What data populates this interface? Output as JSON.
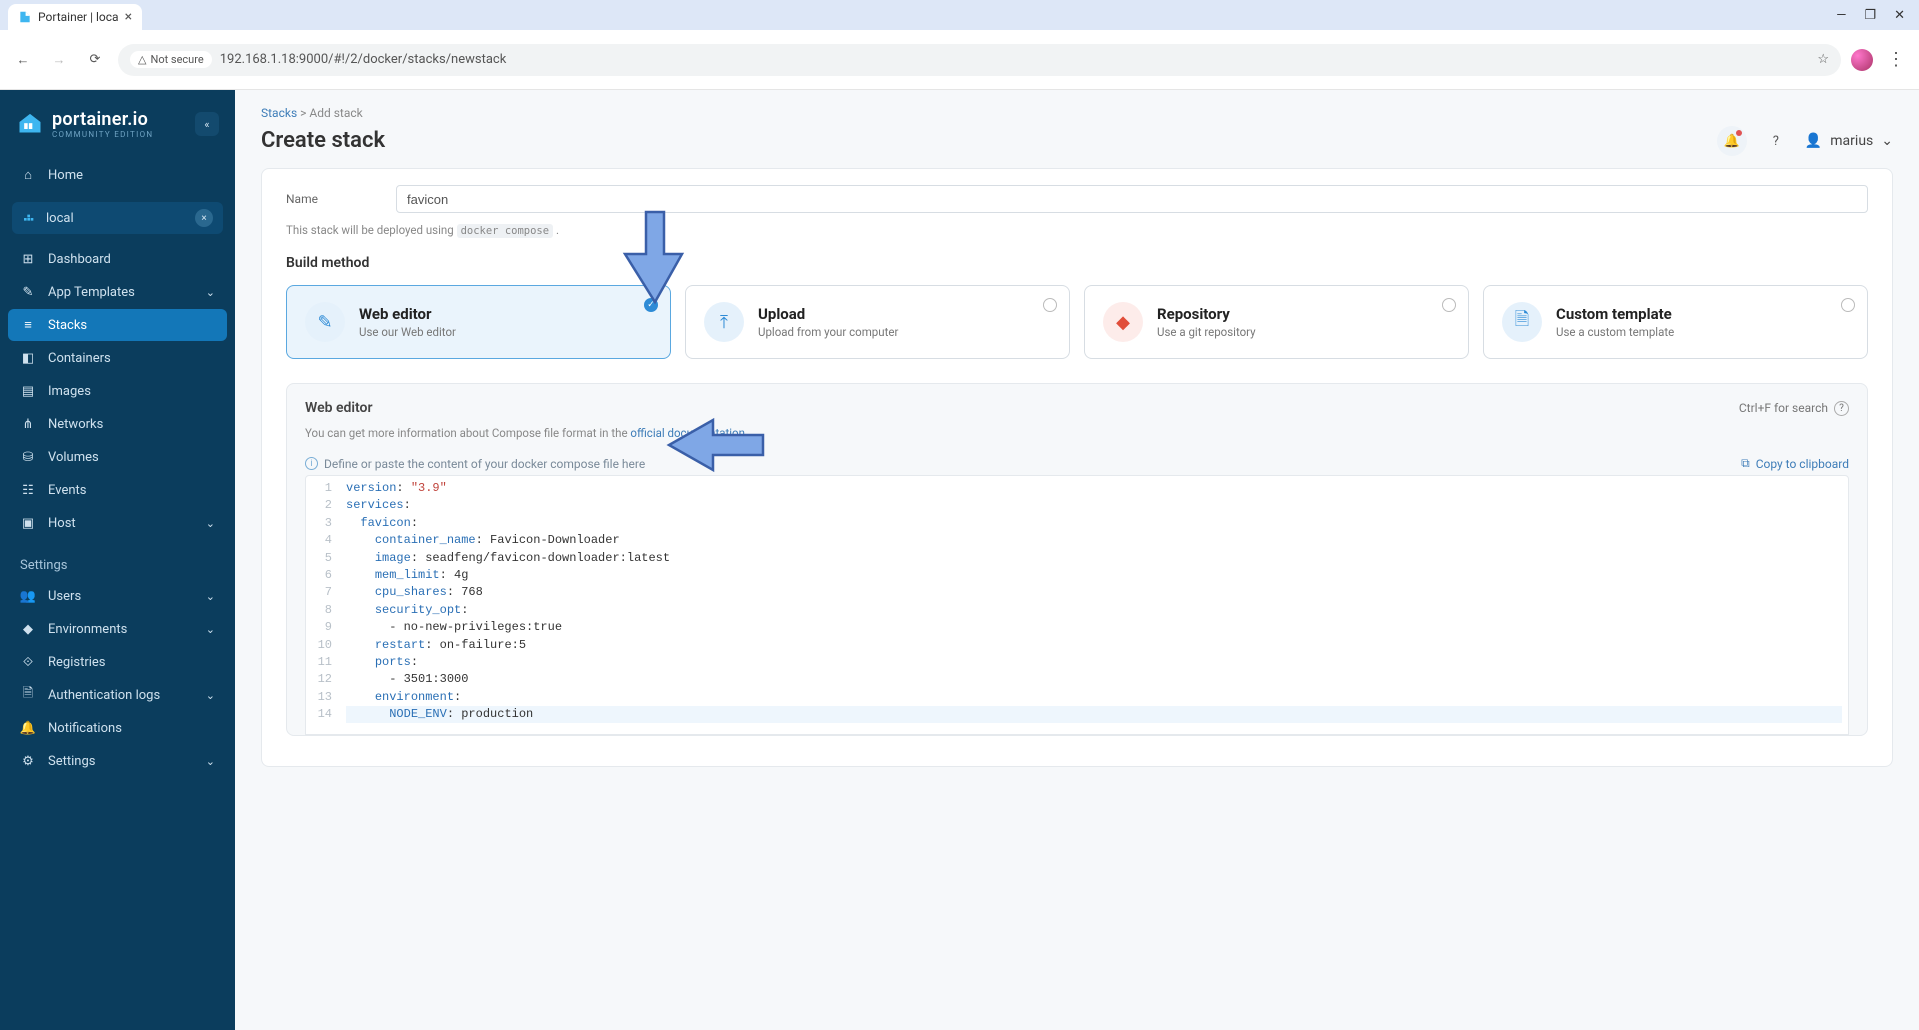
{
  "browser": {
    "tab_title": "Portainer | loca",
    "url": "192.168.1.18:9000/#!/2/docker/stacks/newstack",
    "security_label": "Not secure"
  },
  "brand": {
    "name": "portainer.io",
    "edition": "COMMUNITY EDITION"
  },
  "sidebar": {
    "home": "Home",
    "env_label": "local",
    "items": [
      {
        "label": "Dashboard",
        "icon": "dashboard-icon"
      },
      {
        "label": "App Templates",
        "icon": "template-icon",
        "chev": true
      },
      {
        "label": "Stacks",
        "icon": "stacks-icon",
        "active": true
      },
      {
        "label": "Containers",
        "icon": "containers-icon"
      },
      {
        "label": "Images",
        "icon": "images-icon"
      },
      {
        "label": "Networks",
        "icon": "networks-icon"
      },
      {
        "label": "Volumes",
        "icon": "volumes-icon"
      },
      {
        "label": "Events",
        "icon": "events-icon"
      },
      {
        "label": "Host",
        "icon": "host-icon",
        "chev": true
      }
    ],
    "settings_label": "Settings",
    "settings": [
      {
        "label": "Users",
        "icon": "users-icon",
        "chev": true
      },
      {
        "label": "Environments",
        "icon": "environments-icon",
        "chev": true
      },
      {
        "label": "Registries",
        "icon": "registries-icon"
      },
      {
        "label": "Authentication logs",
        "icon": "authlogs-icon",
        "chev": true
      },
      {
        "label": "Notifications",
        "icon": "bell-icon"
      },
      {
        "label": "Settings",
        "icon": "gear-icon",
        "chev": true
      }
    ]
  },
  "breadcrumbs": {
    "root": "Stacks",
    "sep": ">",
    "current": "Add stack"
  },
  "page_title": "Create stack",
  "user": {
    "name": "marius"
  },
  "form": {
    "name_label": "Name",
    "name_value": "favicon",
    "deploy_hint_prefix": "This stack will be deployed using ",
    "deploy_hint_code": "docker compose",
    "deploy_hint_suffix": " .",
    "build_method_label": "Build method"
  },
  "methods": [
    {
      "title": "Web editor",
      "sub": "Use our Web editor",
      "selected": true,
      "icon": "edit-icon"
    },
    {
      "title": "Upload",
      "sub": "Upload from your computer",
      "icon": "upload-icon"
    },
    {
      "title": "Repository",
      "sub": "Use a git repository",
      "icon": "git-icon"
    },
    {
      "title": "Custom template",
      "sub": "Use a custom template",
      "icon": "file-icon"
    }
  ],
  "editor": {
    "title": "Web editor",
    "search_hint": "Ctrl+F for search",
    "info_prefix": "You can get more information about Compose file format in the ",
    "info_link": "official documentation",
    "info_suffix": ".",
    "placeholder_hint": "Define or paste the content of your docker compose file here",
    "copy_label": "Copy to clipboard",
    "lines": [
      {
        "n": 1,
        "segs": [
          [
            "key",
            "version"
          ],
          [
            "plain",
            ": "
          ],
          [
            "str",
            "\"3.9\""
          ]
        ]
      },
      {
        "n": 2,
        "segs": [
          [
            "key",
            "services"
          ],
          [
            "plain",
            ":"
          ]
        ]
      },
      {
        "n": 3,
        "segs": [
          [
            "plain",
            "  "
          ],
          [
            "key",
            "favicon"
          ],
          [
            "plain",
            ":"
          ]
        ]
      },
      {
        "n": 4,
        "segs": [
          [
            "plain",
            "    "
          ],
          [
            "key",
            "container_name"
          ],
          [
            "plain",
            ": Favicon-Downloader"
          ]
        ]
      },
      {
        "n": 5,
        "segs": [
          [
            "plain",
            "    "
          ],
          [
            "key",
            "image"
          ],
          [
            "plain",
            ": seadfeng/favicon-downloader:latest"
          ]
        ]
      },
      {
        "n": 6,
        "segs": [
          [
            "plain",
            "    "
          ],
          [
            "key",
            "mem_limit"
          ],
          [
            "plain",
            ": 4g"
          ]
        ]
      },
      {
        "n": 7,
        "segs": [
          [
            "plain",
            "    "
          ],
          [
            "key",
            "cpu_shares"
          ],
          [
            "plain",
            ": 768"
          ]
        ]
      },
      {
        "n": 8,
        "segs": [
          [
            "plain",
            "    "
          ],
          [
            "key",
            "security_opt"
          ],
          [
            "plain",
            ":"
          ]
        ]
      },
      {
        "n": 9,
        "segs": [
          [
            "plain",
            "      - no-new-privileges:true"
          ]
        ]
      },
      {
        "n": 10,
        "segs": [
          [
            "plain",
            "    "
          ],
          [
            "key",
            "restart"
          ],
          [
            "plain",
            ": on-failure:5"
          ]
        ]
      },
      {
        "n": 11,
        "segs": [
          [
            "plain",
            "    "
          ],
          [
            "key",
            "ports"
          ],
          [
            "plain",
            ":"
          ]
        ]
      },
      {
        "n": 12,
        "segs": [
          [
            "plain",
            "      - 3501:3000"
          ]
        ]
      },
      {
        "n": 13,
        "segs": [
          [
            "plain",
            "    "
          ],
          [
            "key",
            "environment"
          ],
          [
            "plain",
            ":"
          ]
        ]
      },
      {
        "n": 14,
        "segs": [
          [
            "plain",
            "      "
          ],
          [
            "key",
            "NODE_ENV"
          ],
          [
            "plain",
            ": production"
          ]
        ],
        "hl": true
      }
    ]
  },
  "colors": {
    "arrow": "#7fa7e6",
    "arrow_stroke": "#3a5fa8"
  }
}
